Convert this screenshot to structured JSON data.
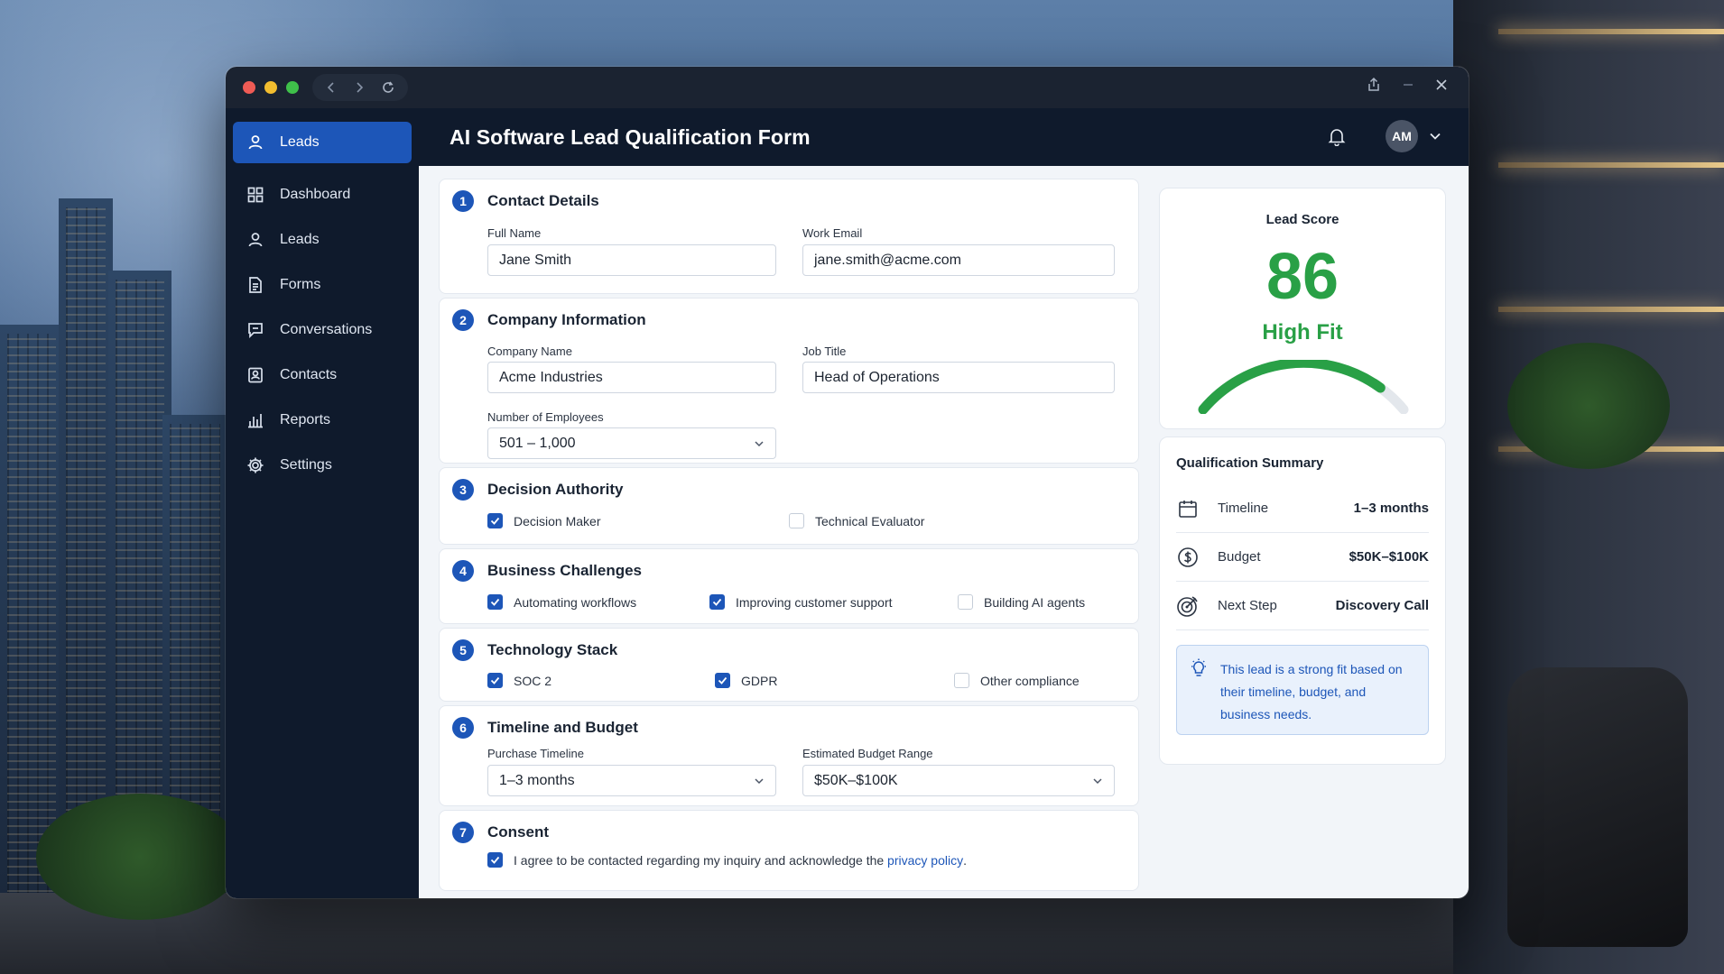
{
  "app": {
    "title": "AI Software Lead Qualification Form",
    "avatar_initials": "AM",
    "accent_color": "#1d56b8",
    "success_color": "#29a046"
  },
  "sidebar": {
    "items": [
      {
        "label": "Leads",
        "icon": "user-icon",
        "active": true
      },
      {
        "label": "Dashboard",
        "icon": "grid-icon"
      },
      {
        "label": "Leads",
        "icon": "user-icon"
      },
      {
        "label": "Forms",
        "icon": "document-icon"
      },
      {
        "label": "Conversations",
        "icon": "chat-icon"
      },
      {
        "label": "Contacts",
        "icon": "contact-card-icon"
      },
      {
        "label": "Reports",
        "icon": "bar-chart-icon"
      },
      {
        "label": "Settings",
        "icon": "gear-icon"
      }
    ]
  },
  "form": {
    "contact": {
      "number": "1",
      "title": "Contact Details",
      "full_name_label": "Full Name",
      "full_name_value": "Jane Smith",
      "email_label": "Work Email",
      "email_value": "jane.smith@acme.com"
    },
    "company": {
      "number": "2",
      "title": "Company Information",
      "company_label": "Company Name",
      "company_value": "Acme Industries",
      "job_label": "Job Title",
      "job_value": "Head of Operations",
      "employees_label": "Number of Employees",
      "employees_value": "501 – 1,000"
    },
    "authority": {
      "number": "3",
      "title": "Decision Authority",
      "options": [
        {
          "label": "Decision Maker",
          "checked": true
        },
        {
          "label": "Technical Evaluator",
          "checked": false
        }
      ]
    },
    "challenges": {
      "number": "4",
      "title": "Business Challenges",
      "options": [
        {
          "label": "Automating workflows",
          "checked": true
        },
        {
          "label": "Improving customer support",
          "checked": true
        },
        {
          "label": "Building AI agents",
          "checked": false
        }
      ]
    },
    "tech": {
      "number": "5",
      "title": "Technology Stack",
      "options": [
        {
          "label": "SOC 2",
          "checked": true
        },
        {
          "label": "GDPR",
          "checked": true
        },
        {
          "label": "Other compliance",
          "checked": false
        }
      ]
    },
    "timeline": {
      "number": "6",
      "title": "Timeline and Budget",
      "timeline_label": "Purchase Timeline",
      "timeline_value": "1–3 months",
      "budget_label": "Estimated Budget Range",
      "budget_value": "$50K–$100K"
    },
    "consent": {
      "number": "7",
      "title": "Consent",
      "checked": true,
      "text": "I agree to be contacted regarding my inquiry and acknowledge the",
      "link": "privacy policy",
      "suffix": "."
    }
  },
  "score": {
    "label": "Lead Score",
    "value": "86",
    "fit": "High Fit",
    "gauge_fraction": 0.86
  },
  "summary": {
    "title": "Qualification Summary",
    "rows": [
      {
        "name": "Timeline",
        "value": "1–3 months",
        "icon": "calendar-icon"
      },
      {
        "name": "Budget",
        "value": "$50K–$100K",
        "icon": "dollar-icon"
      },
      {
        "name": "Next Step",
        "value": "Discovery Call",
        "icon": "target-icon"
      }
    ],
    "note": "This lead is a strong fit based on their timeline, budget, and business needs."
  }
}
